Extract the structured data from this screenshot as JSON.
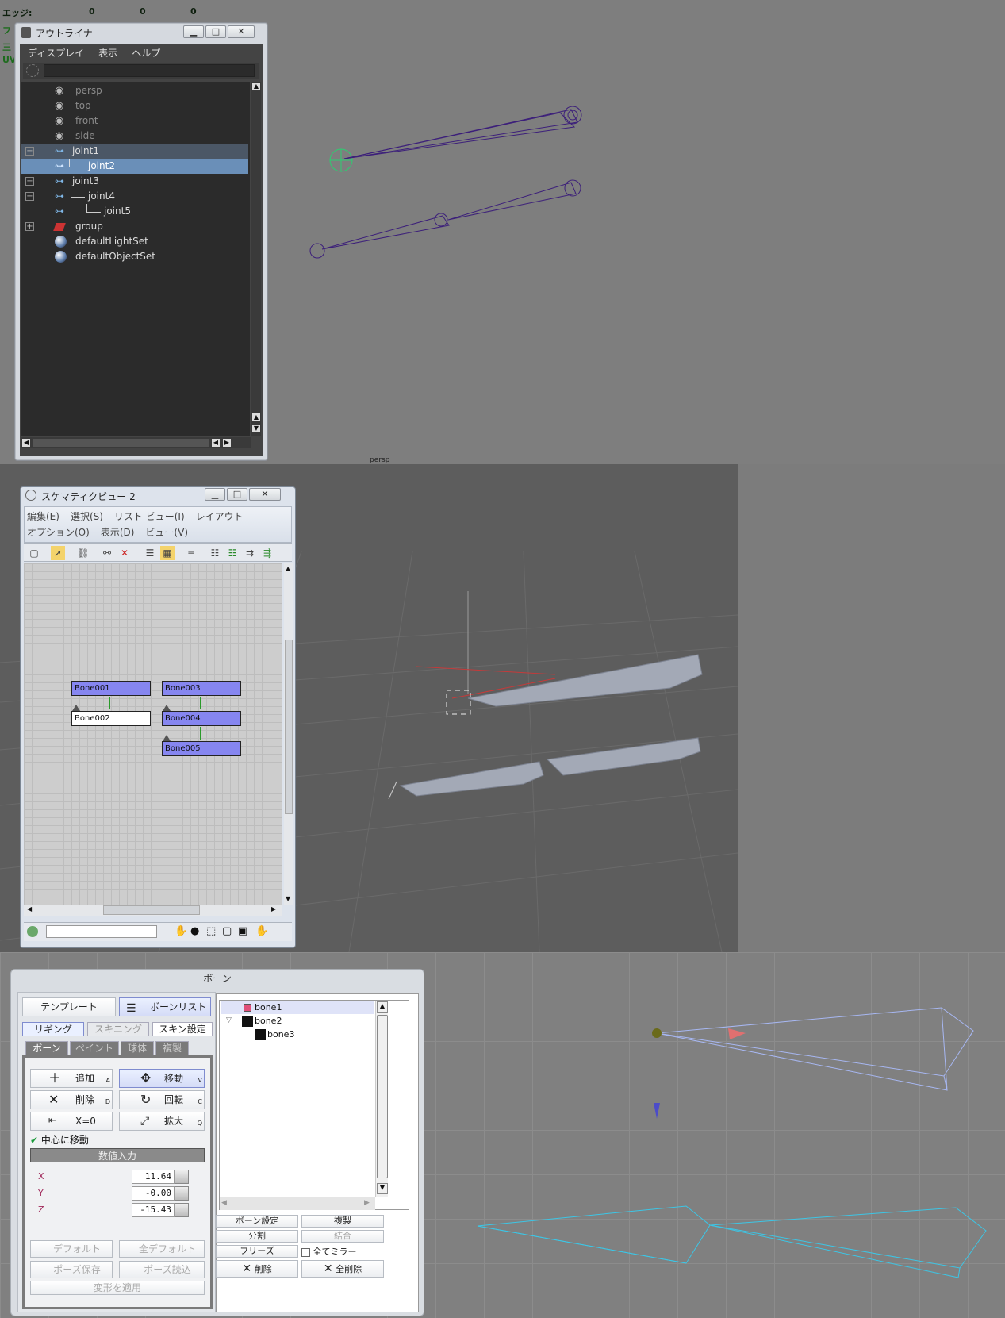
{
  "maya_hud": {
    "rows": [
      {
        "label": "エッジ:",
        "values": [
          "0",
          "0",
          "0"
        ]
      },
      {
        "label": "フ",
        "values": []
      },
      {
        "label": "三",
        "values": []
      },
      {
        "label": "UV",
        "values": []
      }
    ],
    "viewport_label": "persp"
  },
  "outliner": {
    "title": "アウトライナ",
    "menu": [
      "ディスプレイ",
      "表示",
      "ヘルプ"
    ],
    "items": [
      {
        "label": "persp",
        "state": "dim"
      },
      {
        "label": "top",
        "state": "dim"
      },
      {
        "label": "front",
        "state": "dim"
      },
      {
        "label": "side",
        "state": "dim"
      },
      {
        "label": "joint1",
        "state": "sel1"
      },
      {
        "label": "joint2",
        "state": "sel2"
      },
      {
        "label": "joint3",
        "state": "normal"
      },
      {
        "label": "joint4",
        "state": "normal"
      },
      {
        "label": "joint5",
        "state": "normal"
      },
      {
        "label": "group",
        "state": "normal"
      },
      {
        "label": "defaultLightSet",
        "state": "normal"
      },
      {
        "label": "defaultObjectSet",
        "state": "normal"
      }
    ],
    "expand_minus": "−",
    "expand_plus": "+"
  },
  "schematic": {
    "title": "スケマティクビュー 2",
    "menu_row1": [
      "編集(E)",
      "選択(S)",
      "リスト ビュー(I)",
      "レイアウト"
    ],
    "menu_row2": [
      "オプション(O)",
      "表示(D)",
      "ビュー(V)"
    ],
    "nodes": [
      "Bone001",
      "Bone002",
      "Bone003",
      "Bone004",
      "Bone005"
    ]
  },
  "bone_panel": {
    "title": "ボーン",
    "template_btn": "テンプレート",
    "bonelist_btn": "ボーンリスト",
    "mode_tabs": [
      "リギング",
      "スキニング",
      "スキン設定"
    ],
    "sub_tabs": [
      "ボーン",
      "ペイント",
      "球体",
      "複製"
    ],
    "ops": [
      {
        "label": "追加",
        "key": "A"
      },
      {
        "label": "移動",
        "key": "V"
      },
      {
        "label": "削除",
        "key": "D"
      },
      {
        "label": "回転",
        "key": "C"
      },
      {
        "label": "X=0",
        "key": ""
      },
      {
        "label": "拡大",
        "key": "Q"
      }
    ],
    "move_center": "中心に移動",
    "numeric_input": "数値入力",
    "axes": [
      {
        "axis": "X",
        "value": "11.64"
      },
      {
        "axis": "Y",
        "value": "-0.00"
      },
      {
        "axis": "Z",
        "value": "-15.43"
      }
    ],
    "bottom_btns": [
      "デフォルト",
      "全デフォルト",
      "ポーズ保存",
      "ポーズ読込",
      "変形を適用"
    ],
    "bones": [
      {
        "label": "bone1",
        "color": "#e0507a"
      },
      {
        "label": "bone2",
        "color": "#111111"
      },
      {
        "label": "bone3",
        "color": "#111111"
      }
    ],
    "list_btns": [
      "ボーン設定",
      "複製",
      "分割",
      "結合",
      "フリーズ",
      "全てミラー",
      "削除",
      "全削除"
    ]
  },
  "colors": {
    "maya_bg": "#7e7e7e",
    "joint_wire": "#3c1f7a",
    "bone_node": "#8686f0",
    "bone_wire_cyan": "#3cc6e6"
  }
}
